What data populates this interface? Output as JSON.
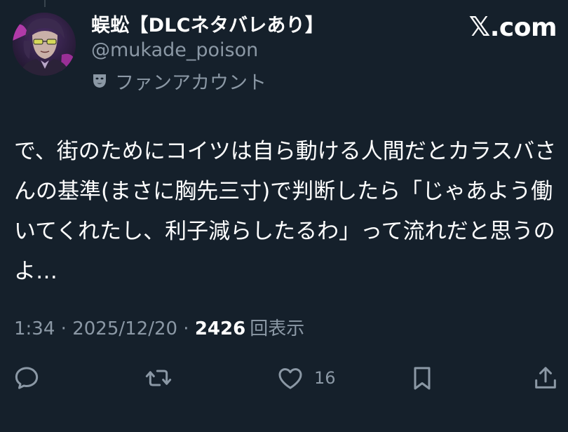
{
  "author": {
    "display_name": "蜈蚣【DLCネタバレあり】",
    "handle": "@mukade_poison",
    "account_label": "ファンアカウント",
    "account_label_icon": "theater-mask-icon"
  },
  "brand": {
    "logo_text": ".com",
    "logo_mark": "𝕏"
  },
  "tweet": {
    "text": "で、街のためにコイツは自ら動ける人間だとカラスバさんの基準(まさに胸先三寸)で判断したら「じゃあよう働いてくれたし、利子減らしたるわ」って流れだと思うのよ…"
  },
  "meta": {
    "time": "1:34",
    "sep1": " · ",
    "date": "2025/12/20",
    "sep2": " · ",
    "views_count": "2426",
    "views_label": "回表示"
  },
  "actions": {
    "reply_icon": "reply-icon",
    "retweet_icon": "retweet-icon",
    "like_icon": "heart-icon",
    "like_count": "16",
    "bookmark_icon": "bookmark-icon",
    "share_icon": "share-icon"
  },
  "colors": {
    "background": "#15202b",
    "text_primary": "#ffffff",
    "text_secondary": "#8b98a5"
  }
}
